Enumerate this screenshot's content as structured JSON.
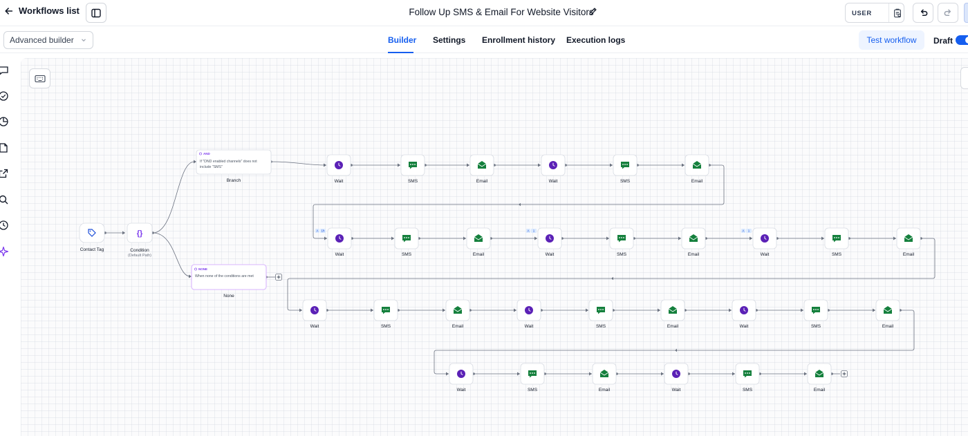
{
  "header": {
    "back_label": "Workflows list",
    "title": "Follow Up SMS & Email For Website Visitors",
    "user_label": "USER"
  },
  "toolbar": {
    "builder_select": "Advanced builder",
    "tabs": [
      {
        "label": "Builder",
        "active": true
      },
      {
        "label": "Settings",
        "active": false
      },
      {
        "label": "Enrollment history",
        "active": false
      },
      {
        "label": "Execution logs",
        "active": false
      }
    ],
    "test_button": "Test workflow",
    "draft_label": "Draft",
    "draft_on": true
  },
  "rail": {
    "icons": [
      "chat-icon",
      "check-circle-icon",
      "pie-chart-icon",
      "document-icon",
      "external-link-icon",
      "search-icon",
      "history-icon",
      "sparkle-icon"
    ]
  },
  "colors": {
    "accent": "#155eef",
    "wait": "#5b21b6",
    "message": "#15803d",
    "condition": "#7c3aed"
  },
  "workflow": {
    "trigger": {
      "label": "Contact Tag"
    },
    "condition": {
      "label": "Condition",
      "sublabel": "(Default Path)"
    },
    "branches": [
      {
        "tag": "AND",
        "text_line1": "If \"DND enabled channels\" does not",
        "text_line2": "include \"SMS\"",
        "label": "Branch"
      },
      {
        "tag": "NONE",
        "text_line1": "When none of the conditions are met",
        "label": "None"
      }
    ],
    "step_types": {
      "wait": "Wait",
      "sms": "SMS",
      "email": "Email"
    },
    "rows": [
      [
        "wait",
        "sms",
        "email",
        "wait",
        "sms",
        "email"
      ],
      [
        "wait",
        "sms",
        "email",
        "wait",
        "sms",
        "email",
        "wait",
        "sms",
        "email"
      ],
      [
        "wait",
        "sms",
        "email",
        "wait",
        "sms",
        "email",
        "wait",
        "sms",
        "email"
      ],
      [
        "wait",
        "sms",
        "email",
        "wait",
        "sms",
        "email"
      ]
    ],
    "badges": [
      "A",
      "1h",
      "A",
      "1",
      "A",
      "1"
    ]
  }
}
